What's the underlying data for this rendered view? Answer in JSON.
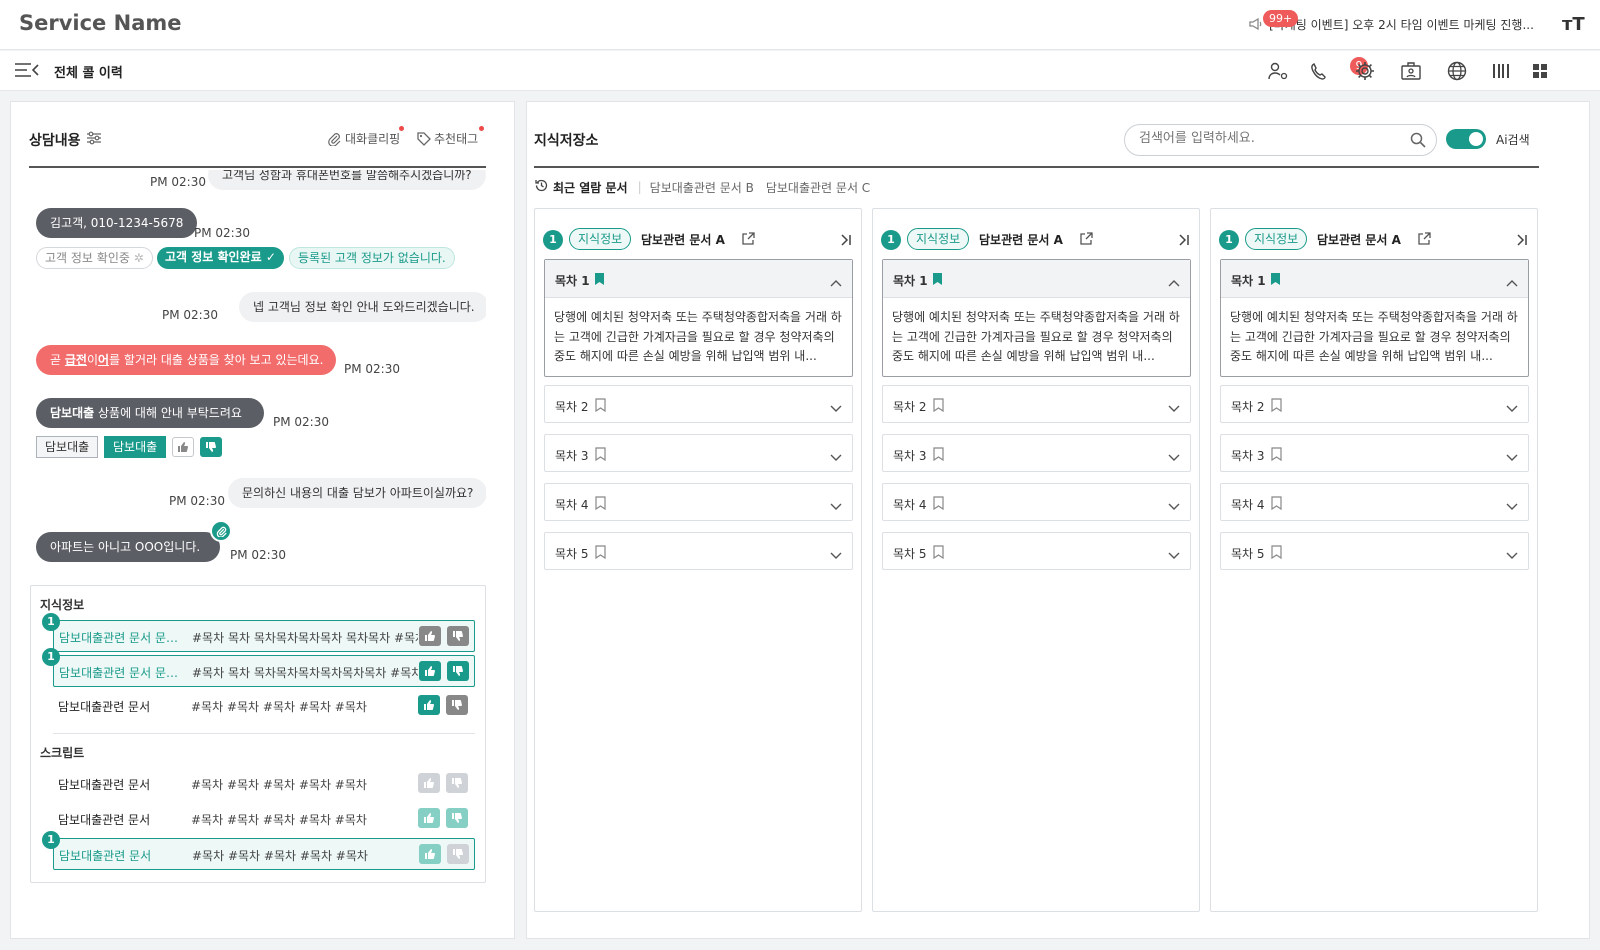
{
  "header": {
    "service_name": "Service Name",
    "notice_badge": "99+",
    "notice_text": "[마케팅 이벤트] 오후 2시 타임 이벤트 마케팅 진행...",
    "font_button": "тT"
  },
  "subheader": {
    "page_title": "전체 콜 이력",
    "alert_badge": "9"
  },
  "consult": {
    "title": "상담내용",
    "clipping_label": "대화클리핑",
    "tag_label": "추천태그",
    "messages": [
      {
        "text": "고객님 성함과 휴대폰번호를 말씀해주시겠습니까?",
        "time": "PM 02:30"
      },
      {
        "text": "김고객, 010-1234-5678",
        "time": "PM 02:30"
      },
      {
        "text": "넵 고객님 정보 확인 안내 도와드리겠습니다.",
        "time": "PM 02:30"
      },
      {
        "text_pre": "곧 ",
        "text_highlight": "급전",
        "text_mid": "이",
        "text_highlight2": "어",
        "text_post": "를 할거라 대출 상품을 찾아 보고 있는데요.",
        "time": "PM 02:30"
      },
      {
        "text_bold": "담보대출",
        "text_post": " 상품에 대해 안내 부탁드려요",
        "time": "PM 02:30"
      },
      {
        "text": "문의하신 내용의 대출 담보가 아파트이실까요?",
        "time": "PM 02:30"
      },
      {
        "text": "아파트는 아니고 OOO입니다.",
        "time": "PM 02:30"
      }
    ],
    "chips": {
      "checking": "고객 정보 확인중",
      "confirmed": "고객 정보 확인완료",
      "none": "등록된 고객 정보가 없습니다."
    },
    "tags": [
      "담보대출",
      "담보대출"
    ]
  },
  "knowledge": {
    "section1": "지식정보",
    "section2": "스크립트",
    "rows1": [
      {
        "num": "1",
        "name": "담보대출관련 문서 문서문서",
        "tags": "#목차 목차 목차목차목차목차 목차목차  #목차"
      },
      {
        "num": "1",
        "name": "담보대출관련 문서 문서문서",
        "tags": "#목차 목차 목차목차목차목차목차목차  #목차 목"
      },
      {
        "num": "",
        "name": "담보대출관련 문서",
        "tags": "#목차  #목차  #목차  #목차  #목차"
      }
    ],
    "rows2": [
      {
        "num": "",
        "name": "담보대출관련 문서",
        "tags": "#목차  #목차  #목차  #목차  #목차"
      },
      {
        "num": "",
        "name": "담보대출관련 문서",
        "tags": "#목차  #목차  #목차  #목차  #목차"
      },
      {
        "num": "1",
        "name": "담보대출관련 문서",
        "tags": "#목차  #목차  #목차  #목차  #목차"
      }
    ]
  },
  "repo": {
    "title": "지식저장소",
    "search_placeholder": "검색어를 입력하세요.",
    "ai_label": "Ai검색",
    "recent_label": "최근 열람 문서",
    "recent_docs": [
      "담보대출관련 문서 B",
      "담보대출관련 문서 C"
    ],
    "columns": [
      {
        "num": "1",
        "pill": "지식정보",
        "title": "담보관련 문서 A"
      },
      {
        "num": "1",
        "pill": "지식정보",
        "title": "담보관련 문서 A"
      },
      {
        "num": "1",
        "pill": "지식정보",
        "title": "담보관련 문서 A"
      }
    ],
    "toc": [
      "목차 1",
      "목차 2",
      "목차 3",
      "목차 4",
      "목차 5"
    ],
    "toc_body": "당행에 예치된 청약저축 또는 주택청약종합저축을 거래 하는 고객에 긴급한 가계자금을 필요로 할 경우 청약저축의 중도 해지에 따른 손실 예방을 위해 납입액 범위 내..."
  },
  "colors": {
    "accent": "#1a9a8a",
    "alert": "#ef5a5a",
    "dark_bubble": "#5b5e64",
    "red_bubble": "#f36c6c"
  }
}
